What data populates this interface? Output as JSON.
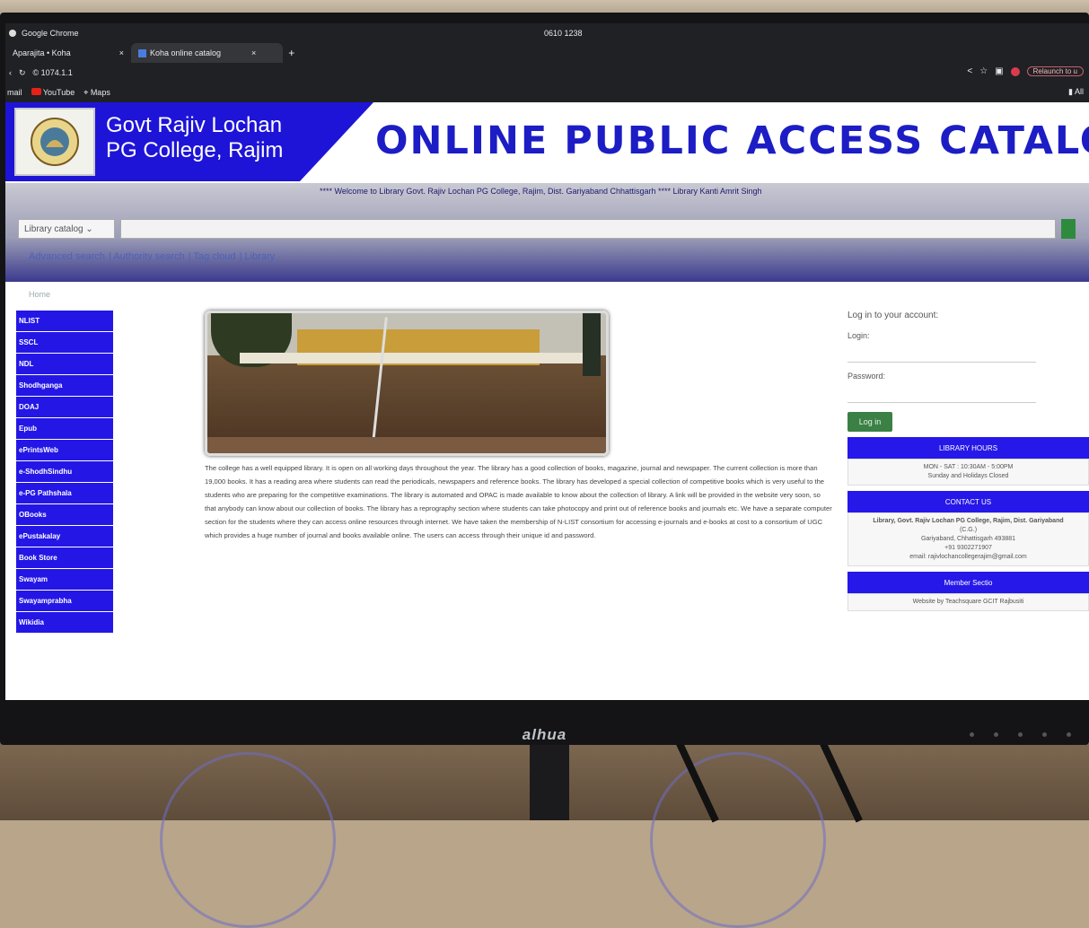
{
  "browser": {
    "app_title": "Google Chrome",
    "clock": "0610 1238",
    "tabs": [
      {
        "label": "Aparajita • Koha"
      },
      {
        "label": "Koha online catalog"
      }
    ],
    "address": "© 1074.1.1",
    "relaunch_label": "Relaunch to u",
    "bookmarks": [
      {
        "label": "mail"
      },
      {
        "label": "YouTube"
      },
      {
        "label": "Maps"
      }
    ],
    "bookmarks_right": "All"
  },
  "banner": {
    "college_line1": "Govt Rajiv Lochan",
    "college_line2": "PG College, Rajim",
    "title": "ONLINE PUBLIC ACCESS CATALOGUE"
  },
  "nav": {
    "marquee": "**** Welcome to Library Govt. Rajiv Lochan PG College, Rajim, Dist. Gariyaband Chhattisgarh **** Library Kanti Amrit Singh",
    "catalog_select": "Library catalog",
    "links": [
      "Advanced search",
      "Authority search",
      "Tag cloud",
      "Library"
    ],
    "breadcrumb": "Home"
  },
  "sidebar": {
    "items": [
      "NLIST",
      "SSCL",
      "NDL",
      "Shodhganga",
      "DOAJ",
      "Epub",
      "ePrintsWeb",
      "e-ShodhSindhu",
      "e-PG Pathshala",
      "OBooks",
      "ePustakalay",
      "Book Store",
      "Swayam",
      "Swayamprabha",
      "Wikidia"
    ]
  },
  "main": {
    "description": "The college has a well equipped library. It is open on all working days throughout the year. The library has a good collection of books, magazine, journal and newspaper. The current collection is more than 19,000 books. It has a reading area where students can read the periodicals, newspapers and reference books. The library has developed a special collection of competitive books which is very useful to the students who are preparing for the competitive examinations. The library is automated and OPAC is made available to know about the collection of library. A link will be provided in the website very soon, so that anybody can know about our collection of books. The library has a reprography section where students can take photocopy and print out of reference books and journals etc. We have a separate computer section for the students where they can access online resources through internet. We have taken the membership of N-LIST consortium for accessing e-journals and e-books at cost to a consortium of UGC which provides a huge number of journal and books available online. The users can access through their unique id and password."
  },
  "login": {
    "heading": "Log in to your account:",
    "login_label": "Login:",
    "password_label": "Password:",
    "button": "Log in"
  },
  "right_panels": {
    "library_hours_title": "LIBRARY HOURS",
    "library_hours_line1": "MON - SAT : 10:30AM - 5:00PM",
    "library_hours_line2": "Sunday and Holidays Closed",
    "contact_title": "CONTACT US",
    "contact_line1": "Library, Govt. Rajiv Lochan PG College, Rajim, Dist. Gariyaband",
    "contact_line2": "(C.G.)",
    "contact_line3": "Gariyaband, Chhattisgarh 493881",
    "contact_line4": "+91 9302271907",
    "contact_line5": "email: rajivlochancollegerajim@gmail.com",
    "member_title": "Member Sectio",
    "member_line": "Website by Teachsquare GCIT Rajbusiti"
  },
  "monitor": {
    "brand": "alhua"
  },
  "colors": {
    "banner_blue": "#1e14d8",
    "title_blue": "#1c1dc4",
    "sidebar_blue": "#2417e6",
    "login_green": "#3b8045"
  }
}
